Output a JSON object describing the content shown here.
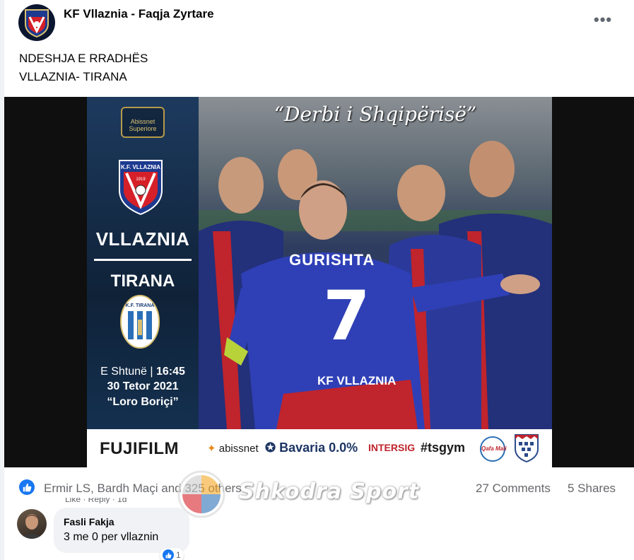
{
  "post": {
    "page_name": "KF Vllaznia - Faqja Zyrtare",
    "more_icon": "more-dots-icon",
    "text_lines": [
      "NDESHJA E RRADHËS",
      "VLLAZNIA- TIRANA"
    ]
  },
  "poster": {
    "title": "“Derbi i Shqipërisë”",
    "superiore_logo": "Abissnet Superiore",
    "team1": "VLLAZNIA",
    "team1_crest": "K.F. VLLAZNIA",
    "team1_crest_year": "1919",
    "team2": "TIRANA",
    "team2_crest": "K.F. TIRANA",
    "day_prefix": "E Shtunë |",
    "time": "16:45",
    "date": "30 Tetor 2021",
    "stadium": "“Loro Boriçi”",
    "jersey_name": "GURISHTA",
    "jersey_number": "7",
    "jersey_club": "KF VLLAZNIA",
    "sponsors": [
      "FUJIFILM",
      "abissnet",
      "Bavaria 0.0%",
      "INTERSIG",
      "#tsgym",
      "Qafa Mali",
      ""
    ]
  },
  "stats": {
    "reactors": "Ermir LS, Bardh Maçi and 325 others",
    "comments": "27 Comments",
    "shares": "5 Shares"
  },
  "watermark": {
    "text": "Shkodra Sport"
  },
  "previous_comment_actions": "Like · Reply · 1d",
  "comment": {
    "author": "Fasli Fakja",
    "text": "3 me 0 per vllaznin",
    "reaction_count": "1"
  },
  "colors": {
    "facebook_blue": "#1877f2",
    "club_red": "#d62029",
    "club_blue": "#1d3a8f",
    "secondary_text": "#65676b"
  }
}
